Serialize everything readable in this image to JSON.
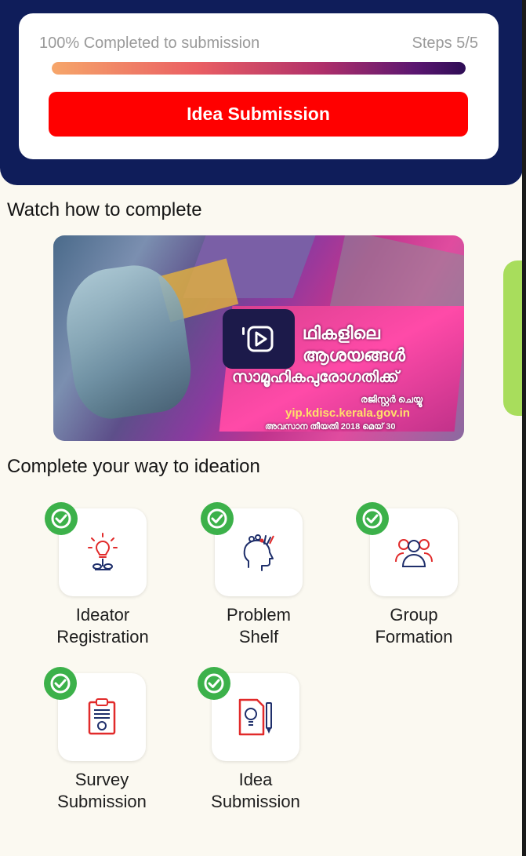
{
  "progress": {
    "status_text": "100% Completed to submission",
    "steps_text": "Steps 5/5",
    "percent": 100,
    "submit_label": "Idea  Submission"
  },
  "video_section": {
    "title": "Watch how to complete",
    "thumbnail": {
      "line1": "ഥികളിലെ",
      "line2": "ആശയങ്ങൾ",
      "line3": "സാമൂഹികപുരോഗതിക്ക്",
      "line4": "രജിസ്റ്റർ ചെയ്യൂ",
      "url": "yip.kdisc.kerala.gov.in",
      "line5": "അവസാന തീയതി 2018 മെയ് 30"
    }
  },
  "steps_section": {
    "title": "Complete your way to ideation",
    "items": [
      {
        "label_line1": "Ideator",
        "label_line2": "Registration",
        "icon": "lightbulb-icon",
        "completed": true
      },
      {
        "label_line1": "Problem",
        "label_line2": "Shelf",
        "icon": "head-gears-icon",
        "completed": true
      },
      {
        "label_line1": "Group",
        "label_line2": "Formation",
        "icon": "group-icon",
        "completed": true
      },
      {
        "label_line1": "Survey",
        "label_line2": "Submission",
        "icon": "clipboard-icon",
        "completed": true
      },
      {
        "label_line1": "Idea",
        "label_line2": "Submission",
        "icon": "idea-document-icon",
        "completed": true
      }
    ]
  },
  "colors": {
    "header": "#0f1d5a",
    "submit": "#ff0000",
    "check": "#3cb14a",
    "icon_red": "#e12a2a",
    "icon_blue": "#1f2f6b",
    "side_tab": "#a8dd5c"
  }
}
